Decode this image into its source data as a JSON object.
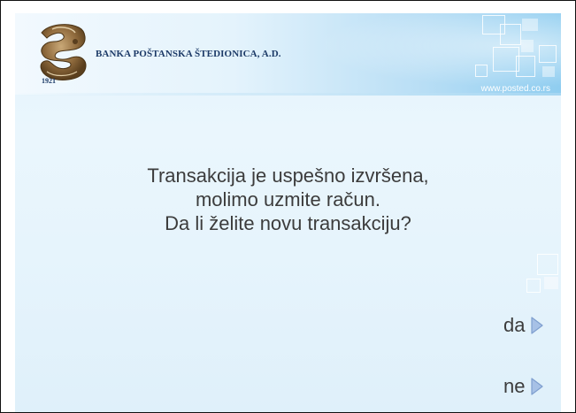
{
  "header": {
    "bank_name": "BANKA POŠTANSKA ŠTEDIONICA, A.D.",
    "logo_year": "1921",
    "url": "www.posted.co.rs"
  },
  "message": {
    "line1": "Transakcija je uspešno izvršena,",
    "line2": "molimo uzmite račun.",
    "line3": "Da li želite novu transakciju?"
  },
  "options": {
    "yes_label": "da",
    "no_label": "ne"
  },
  "colors": {
    "text": "#3c3c3c",
    "arrow": "#8eaed8",
    "bank_name": "#1c3a67"
  }
}
